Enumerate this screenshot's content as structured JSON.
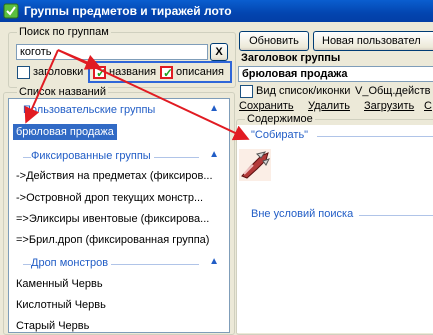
{
  "window": {
    "title": "Группы предметов и тиражей лото"
  },
  "search": {
    "group_label": "Поиск по группам",
    "value": "коготь",
    "clear_label": "X",
    "options": [
      {
        "label": "заголовки",
        "checked": false
      },
      {
        "label": "названия",
        "checked": true
      },
      {
        "label": "описания",
        "checked": true
      }
    ]
  },
  "names_list": {
    "label": "Список названий",
    "sections": [
      {
        "title": "Пользовательские группы",
        "items": [
          "брюловая продажа"
        ],
        "selected": 0
      },
      {
        "title": "Фиксированные группы",
        "items": [
          "->Действия на предметах (фиксиров...",
          "->Островной дроп текущих монстр...",
          "=>Эликсиры ивентовые (фиксирова...",
          "=>Брил.дроп (фиксированная группа)"
        ]
      },
      {
        "title": "Дроп монстров",
        "items": [
          "Каменный Червь",
          "Кислотный Червь",
          "Старый Червь"
        ]
      }
    ]
  },
  "toolbar": {
    "refresh_label": "Обновить",
    "new_label": "Новая пользовател"
  },
  "group": {
    "title_label": "Заголовок группы",
    "title_value": "брюловая продажа",
    "view_label": "Вид список/иконки",
    "view_link": "V_Общ.действ",
    "save_label": "Сохранить",
    "delete_label": "Удалить",
    "load_label": "Загрузить",
    "extra_label": "С"
  },
  "content": {
    "label": "Содержимое",
    "section1": "\"Собирать\"",
    "item_icon": "claw-item-icon",
    "section2": "Вне условий поиска"
  },
  "colors": {
    "accent": "#215dc6",
    "selection": "#316ac5",
    "arrow": "#e11b22",
    "highlight_box": "#2f66d8"
  }
}
